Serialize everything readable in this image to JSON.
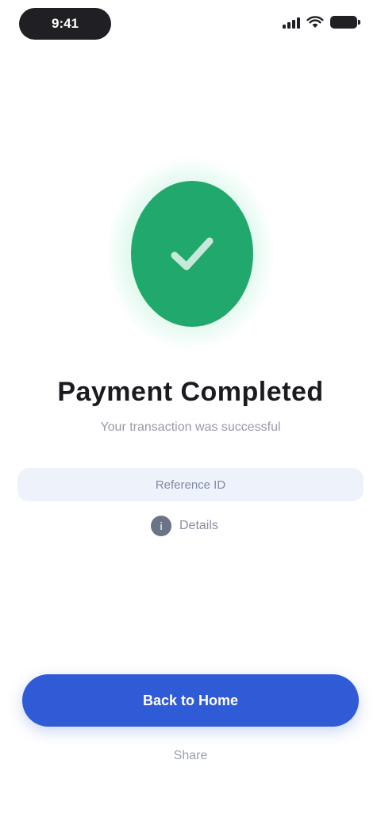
{
  "status_bar": {
    "time": "9:41",
    "icons": [
      "signal-icon",
      "wifi-icon",
      "battery-icon"
    ]
  },
  "success": {
    "icon": "check-icon",
    "circle_color": "#21a86c",
    "glow_color": "#30d68c"
  },
  "content": {
    "title": "Payment Completed",
    "subtitle": "Your transaction was successful"
  },
  "info_card": {
    "text": "Reference ID"
  },
  "secondary_row": {
    "icon": "info-icon",
    "label": "Details"
  },
  "actions": {
    "primary_label": "Back to Home",
    "primary_color": "#2f5bd6",
    "secondary_label": "Share"
  }
}
